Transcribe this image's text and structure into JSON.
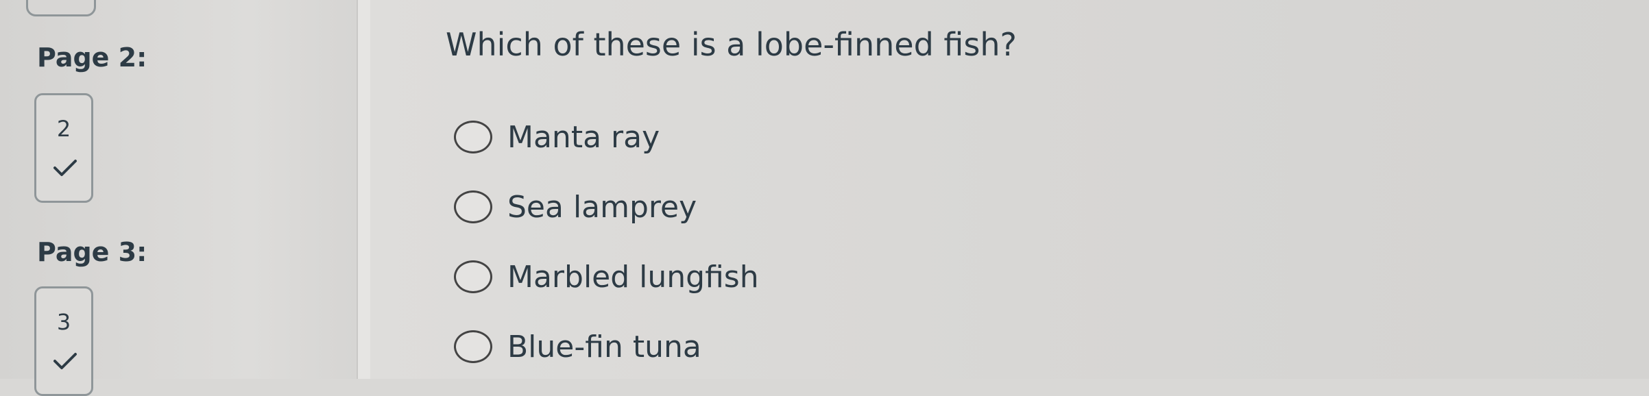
{
  "sidebar": {
    "pages": [
      {
        "label": "Page 2:",
        "number": "2",
        "answered": true
      },
      {
        "label": "Page 3:",
        "number": "3",
        "answered": true
      }
    ]
  },
  "question": {
    "text": "Which of these is a lobe-finned fish?",
    "options": [
      {
        "label": "Manta ray",
        "selected": false
      },
      {
        "label": "Sea lamprey",
        "selected": false
      },
      {
        "label": "Marbled lungfish",
        "selected": false
      },
      {
        "label": "Blue-fin tuna",
        "selected": false
      }
    ]
  }
}
